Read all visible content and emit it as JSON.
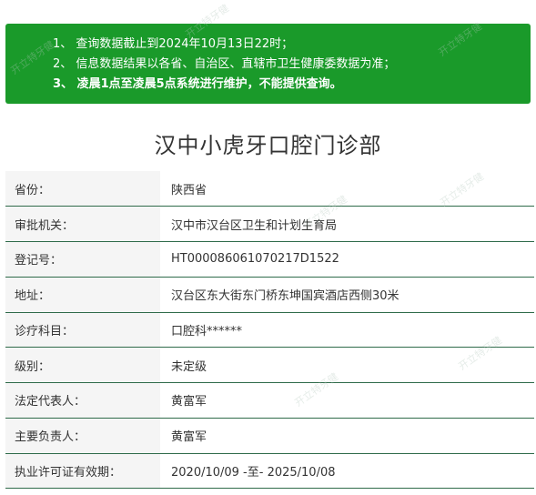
{
  "notice": {
    "line1": "1、 查询数据截止到2024年10月13日22时；",
    "line2": "2、 信息数据结果以各省、自治区、直辖市卫生健康委数据为准；",
    "line3": "3、 凌晨1点至凌晨5点系统进行维护，不能提供查询。"
  },
  "clinic": {
    "name": "汉中小虎牙口腔门诊部"
  },
  "rows": [
    {
      "label": "省份：",
      "value": "陕西省"
    },
    {
      "label": "审批机关：",
      "value": "汉中市汉台区卫生和计划生育局"
    },
    {
      "label": "登记号：",
      "value": "HT000086061070217D1522"
    },
    {
      "label": "地址：",
      "value": "汉台区东大街东门桥东坤国宾酒店西侧30米"
    },
    {
      "label": "诊疗科目：",
      "value": "口腔科******"
    },
    {
      "label": "级别：",
      "value": "未定级"
    },
    {
      "label": "法定代表人：",
      "value": "黄富军"
    },
    {
      "label": "主要负责人：",
      "value": "黄富军"
    },
    {
      "label": "执业许可证有效期：",
      "value": "2020/10/09 -至- 2025/10/08"
    }
  ],
  "watermark": {
    "text": "开立特牙健"
  },
  "colors": {
    "notice_bg": "#1a9a2a",
    "row_border": "#2f6b4a",
    "label_bg": "#f5f5f5"
  }
}
